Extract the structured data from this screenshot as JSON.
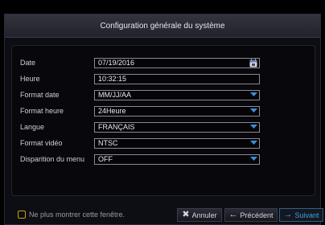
{
  "dialog": {
    "title": "Configuration générale du système"
  },
  "form": {
    "rows": [
      {
        "label": "Date",
        "value": "07/19/2016",
        "control": "calendar"
      },
      {
        "label": "Heure",
        "value": "10:32:15",
        "control": "text"
      },
      {
        "label": "Format date",
        "value": "MM/JJ/AA",
        "control": "dropdown"
      },
      {
        "label": "Format heure",
        "value": "24Heure",
        "control": "dropdown"
      },
      {
        "label": "Langue",
        "value": "FRANÇAIS",
        "control": "dropdown"
      },
      {
        "label": "Format vidéo",
        "value": "NTSC",
        "control": "dropdown"
      },
      {
        "label": "Disparition du menu",
        "value": "OFF",
        "control": "dropdown"
      }
    ]
  },
  "footer": {
    "dont_show_label": "Ne plus montrer cette fenêtre.",
    "cancel_label": "Annuler",
    "previous_label": "Précédent",
    "next_label": "Suivant"
  },
  "colors": {
    "accent": "#3aa6e8",
    "dropdown_arrow": "#3a8fd8",
    "checkbox_border": "#c9a600"
  },
  "icons": {
    "calendar": "calendar-icon",
    "dropdown": "chevron-down-icon",
    "cancel": "close-icon",
    "previous": "arrow-left-icon",
    "next": "arrow-right-icon"
  }
}
